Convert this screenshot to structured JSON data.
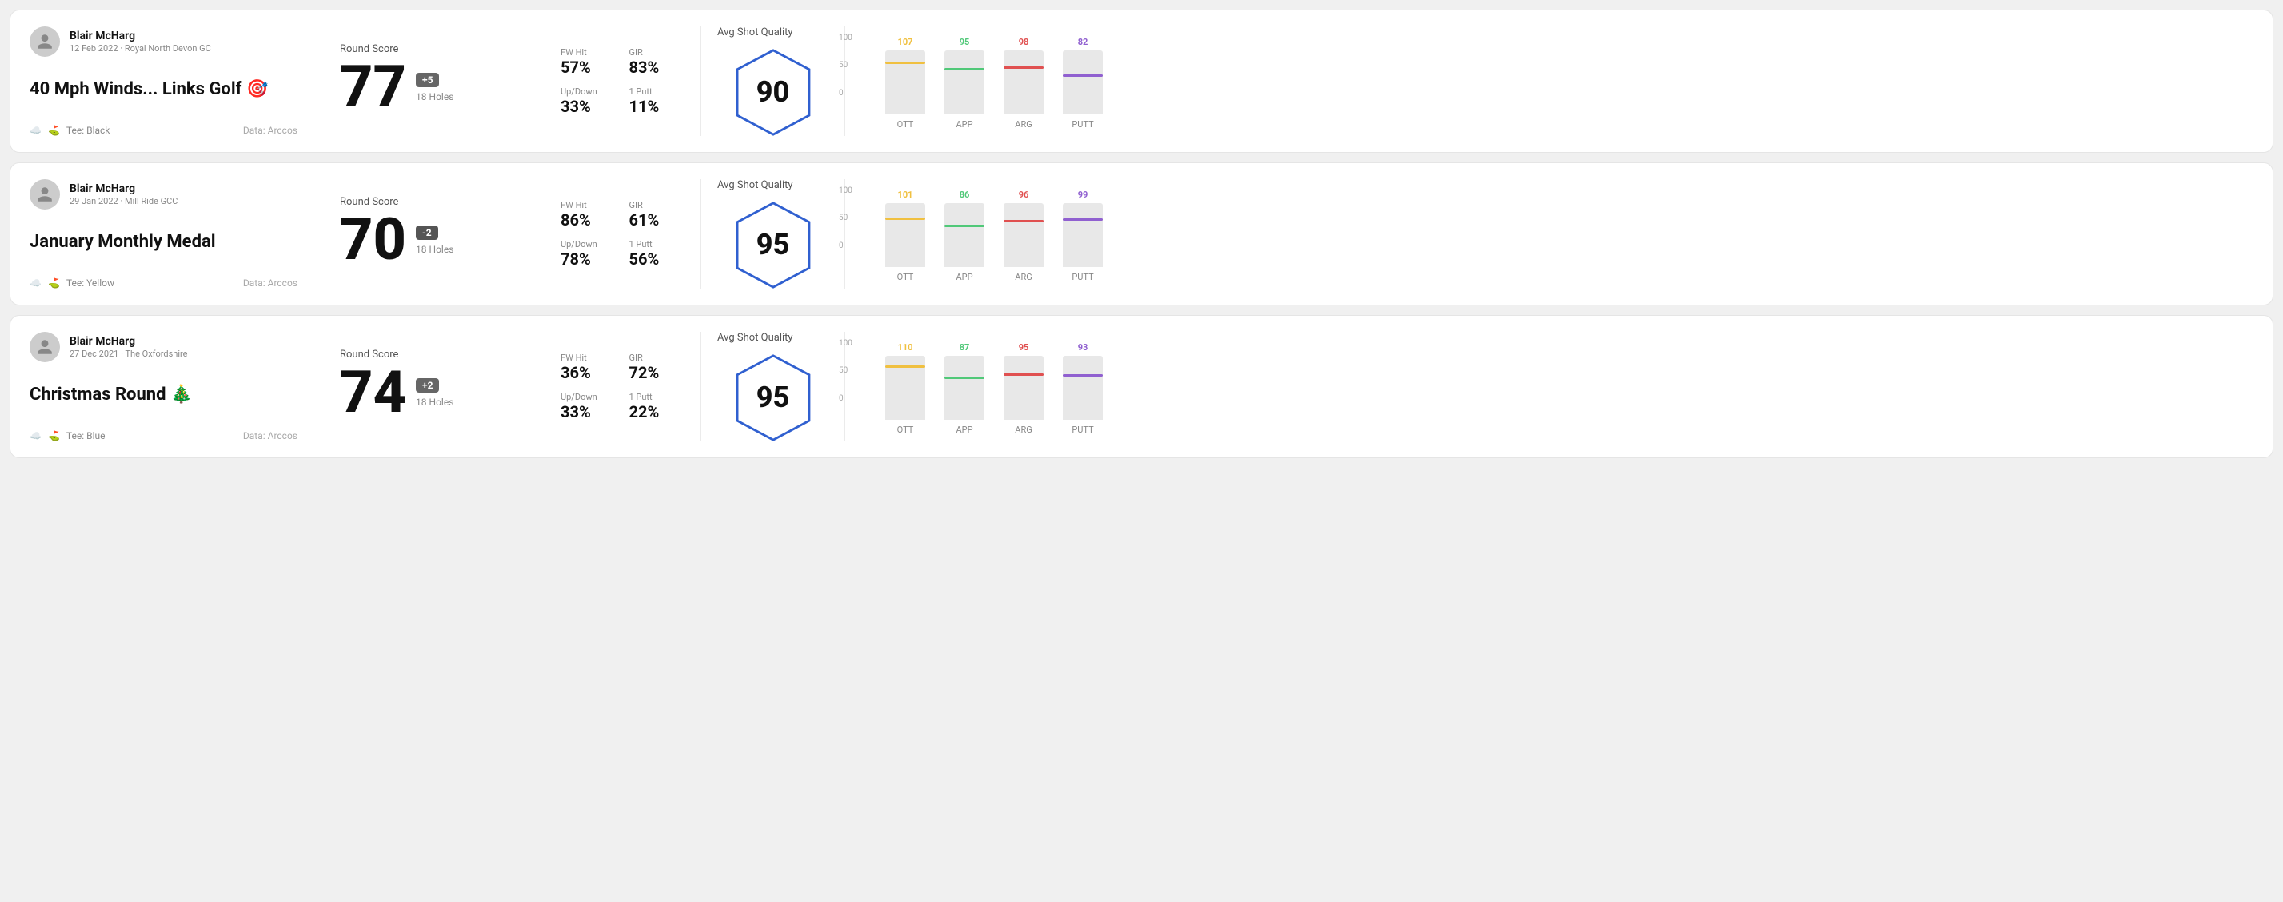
{
  "cards": [
    {
      "id": "card1",
      "user": {
        "name": "Blair McHarg",
        "date_course": "12 Feb 2022 · Royal North Devon GC"
      },
      "title": "40 Mph Winds... Links Golf 🎯",
      "tee": "Black",
      "data_source": "Data: Arccos",
      "round_score_label": "Round Score",
      "score": "77",
      "badge": "+5",
      "badge_type": "over",
      "holes": "18 Holes",
      "fw_hit_label": "FW Hit",
      "fw_hit": "57%",
      "gir_label": "GIR",
      "gir": "83%",
      "up_down_label": "Up/Down",
      "up_down": "33%",
      "one_putt_label": "1 Putt",
      "one_putt": "11%",
      "avg_quality_label": "Avg Shot Quality",
      "quality_score": "90",
      "chart": {
        "bars": [
          {
            "label": "OTT",
            "value": 107,
            "color": "#f0c040",
            "max": 130
          },
          {
            "label": "APP",
            "value": 95,
            "color": "#50c878",
            "max": 130
          },
          {
            "label": "ARG",
            "value": 98,
            "color": "#e05050",
            "max": 130
          },
          {
            "label": "PUTT",
            "value": 82,
            "color": "#9060d0",
            "max": 130
          }
        ]
      }
    },
    {
      "id": "card2",
      "user": {
        "name": "Blair McHarg",
        "date_course": "29 Jan 2022 · Mill Ride GCC"
      },
      "title": "January Monthly Medal",
      "tee": "Yellow",
      "data_source": "Data: Arccos",
      "round_score_label": "Round Score",
      "score": "70",
      "badge": "-2",
      "badge_type": "under",
      "holes": "18 Holes",
      "fw_hit_label": "FW Hit",
      "fw_hit": "86%",
      "gir_label": "GIR",
      "gir": "61%",
      "up_down_label": "Up/Down",
      "up_down": "78%",
      "one_putt_label": "1 Putt",
      "one_putt": "56%",
      "avg_quality_label": "Avg Shot Quality",
      "quality_score": "95",
      "chart": {
        "bars": [
          {
            "label": "OTT",
            "value": 101,
            "color": "#f0c040",
            "max": 130
          },
          {
            "label": "APP",
            "value": 86,
            "color": "#50c878",
            "max": 130
          },
          {
            "label": "ARG",
            "value": 96,
            "color": "#e05050",
            "max": 130
          },
          {
            "label": "PUTT",
            "value": 99,
            "color": "#9060d0",
            "max": 130
          }
        ]
      }
    },
    {
      "id": "card3",
      "user": {
        "name": "Blair McHarg",
        "date_course": "27 Dec 2021 · The Oxfordshire"
      },
      "title": "Christmas Round 🎄",
      "tee": "Blue",
      "data_source": "Data: Arccos",
      "round_score_label": "Round Score",
      "score": "74",
      "badge": "+2",
      "badge_type": "over",
      "holes": "18 Holes",
      "fw_hit_label": "FW Hit",
      "fw_hit": "36%",
      "gir_label": "GIR",
      "gir": "72%",
      "up_down_label": "Up/Down",
      "up_down": "33%",
      "one_putt_label": "1 Putt",
      "one_putt": "22%",
      "avg_quality_label": "Avg Shot Quality",
      "quality_score": "95",
      "chart": {
        "bars": [
          {
            "label": "OTT",
            "value": 110,
            "color": "#f0c040",
            "max": 130
          },
          {
            "label": "APP",
            "value": 87,
            "color": "#50c878",
            "max": 130
          },
          {
            "label": "ARG",
            "value": 95,
            "color": "#e05050",
            "max": 130
          },
          {
            "label": "PUTT",
            "value": 93,
            "color": "#9060d0",
            "max": 130
          }
        ]
      }
    }
  ],
  "axis_labels": {
    "top": "100",
    "mid": "50",
    "bottom": "0"
  }
}
